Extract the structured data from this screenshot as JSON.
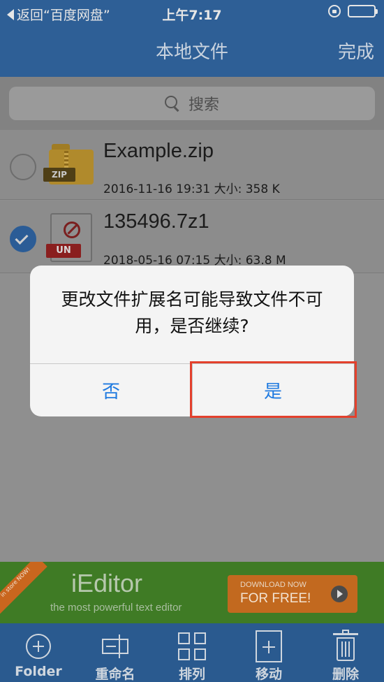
{
  "status_bar": {
    "back_app": "返回“百度网盘”",
    "time": "上午7:17"
  },
  "nav": {
    "title": "本地文件",
    "done": "完成"
  },
  "search": {
    "placeholder": "搜索"
  },
  "files": [
    {
      "name": "Example.zip",
      "meta": "2016-11-16 19:31 大小: 358 K",
      "badge": "ZIP",
      "selected": false
    },
    {
      "name": "135496.7z1",
      "meta": "2018-05-16 07:15 大小: 63.8 M",
      "badge": "UN",
      "selected": true
    }
  ],
  "dialog": {
    "message": "更改文件扩展名可能导致文件不可用，是否继续?",
    "no": "否",
    "yes": "是"
  },
  "ad": {
    "ribbon": "in store NOW!",
    "title": "iEditor",
    "subtitle": "the most powerful text editor",
    "cta_small": "DOWNLOAD NOW",
    "cta_big": "FOR FREE!"
  },
  "toolbar": {
    "folder": "Folder",
    "rename": "重命名",
    "sort": "排列",
    "move": "移动",
    "delete": "删除"
  }
}
